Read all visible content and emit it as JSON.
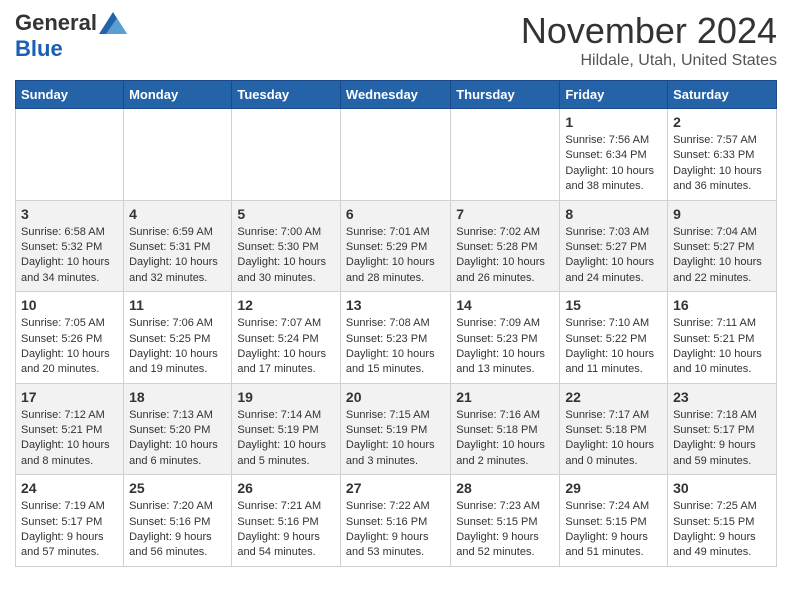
{
  "header": {
    "logo_general": "General",
    "logo_blue": "Blue",
    "title": "November 2024",
    "location": "Hildale, Utah, United States"
  },
  "columns": [
    "Sunday",
    "Monday",
    "Tuesday",
    "Wednesday",
    "Thursday",
    "Friday",
    "Saturday"
  ],
  "weeks": [
    [
      {
        "day": "",
        "info": ""
      },
      {
        "day": "",
        "info": ""
      },
      {
        "day": "",
        "info": ""
      },
      {
        "day": "",
        "info": ""
      },
      {
        "day": "",
        "info": ""
      },
      {
        "day": "1",
        "info": "Sunrise: 7:56 AM\nSunset: 6:34 PM\nDaylight: 10 hours and 38 minutes."
      },
      {
        "day": "2",
        "info": "Sunrise: 7:57 AM\nSunset: 6:33 PM\nDaylight: 10 hours and 36 minutes."
      }
    ],
    [
      {
        "day": "3",
        "info": "Sunrise: 6:58 AM\nSunset: 5:32 PM\nDaylight: 10 hours and 34 minutes."
      },
      {
        "day": "4",
        "info": "Sunrise: 6:59 AM\nSunset: 5:31 PM\nDaylight: 10 hours and 32 minutes."
      },
      {
        "day": "5",
        "info": "Sunrise: 7:00 AM\nSunset: 5:30 PM\nDaylight: 10 hours and 30 minutes."
      },
      {
        "day": "6",
        "info": "Sunrise: 7:01 AM\nSunset: 5:29 PM\nDaylight: 10 hours and 28 minutes."
      },
      {
        "day": "7",
        "info": "Sunrise: 7:02 AM\nSunset: 5:28 PM\nDaylight: 10 hours and 26 minutes."
      },
      {
        "day": "8",
        "info": "Sunrise: 7:03 AM\nSunset: 5:27 PM\nDaylight: 10 hours and 24 minutes."
      },
      {
        "day": "9",
        "info": "Sunrise: 7:04 AM\nSunset: 5:27 PM\nDaylight: 10 hours and 22 minutes."
      }
    ],
    [
      {
        "day": "10",
        "info": "Sunrise: 7:05 AM\nSunset: 5:26 PM\nDaylight: 10 hours and 20 minutes."
      },
      {
        "day": "11",
        "info": "Sunrise: 7:06 AM\nSunset: 5:25 PM\nDaylight: 10 hours and 19 minutes."
      },
      {
        "day": "12",
        "info": "Sunrise: 7:07 AM\nSunset: 5:24 PM\nDaylight: 10 hours and 17 minutes."
      },
      {
        "day": "13",
        "info": "Sunrise: 7:08 AM\nSunset: 5:23 PM\nDaylight: 10 hours and 15 minutes."
      },
      {
        "day": "14",
        "info": "Sunrise: 7:09 AM\nSunset: 5:23 PM\nDaylight: 10 hours and 13 minutes."
      },
      {
        "day": "15",
        "info": "Sunrise: 7:10 AM\nSunset: 5:22 PM\nDaylight: 10 hours and 11 minutes."
      },
      {
        "day": "16",
        "info": "Sunrise: 7:11 AM\nSunset: 5:21 PM\nDaylight: 10 hours and 10 minutes."
      }
    ],
    [
      {
        "day": "17",
        "info": "Sunrise: 7:12 AM\nSunset: 5:21 PM\nDaylight: 10 hours and 8 minutes."
      },
      {
        "day": "18",
        "info": "Sunrise: 7:13 AM\nSunset: 5:20 PM\nDaylight: 10 hours and 6 minutes."
      },
      {
        "day": "19",
        "info": "Sunrise: 7:14 AM\nSunset: 5:19 PM\nDaylight: 10 hours and 5 minutes."
      },
      {
        "day": "20",
        "info": "Sunrise: 7:15 AM\nSunset: 5:19 PM\nDaylight: 10 hours and 3 minutes."
      },
      {
        "day": "21",
        "info": "Sunrise: 7:16 AM\nSunset: 5:18 PM\nDaylight: 10 hours and 2 minutes."
      },
      {
        "day": "22",
        "info": "Sunrise: 7:17 AM\nSunset: 5:18 PM\nDaylight: 10 hours and 0 minutes."
      },
      {
        "day": "23",
        "info": "Sunrise: 7:18 AM\nSunset: 5:17 PM\nDaylight: 9 hours and 59 minutes."
      }
    ],
    [
      {
        "day": "24",
        "info": "Sunrise: 7:19 AM\nSunset: 5:17 PM\nDaylight: 9 hours and 57 minutes."
      },
      {
        "day": "25",
        "info": "Sunrise: 7:20 AM\nSunset: 5:16 PM\nDaylight: 9 hours and 56 minutes."
      },
      {
        "day": "26",
        "info": "Sunrise: 7:21 AM\nSunset: 5:16 PM\nDaylight: 9 hours and 54 minutes."
      },
      {
        "day": "27",
        "info": "Sunrise: 7:22 AM\nSunset: 5:16 PM\nDaylight: 9 hours and 53 minutes."
      },
      {
        "day": "28",
        "info": "Sunrise: 7:23 AM\nSunset: 5:15 PM\nDaylight: 9 hours and 52 minutes."
      },
      {
        "day": "29",
        "info": "Sunrise: 7:24 AM\nSunset: 5:15 PM\nDaylight: 9 hours and 51 minutes."
      },
      {
        "day": "30",
        "info": "Sunrise: 7:25 AM\nSunset: 5:15 PM\nDaylight: 9 hours and 49 minutes."
      }
    ]
  ]
}
